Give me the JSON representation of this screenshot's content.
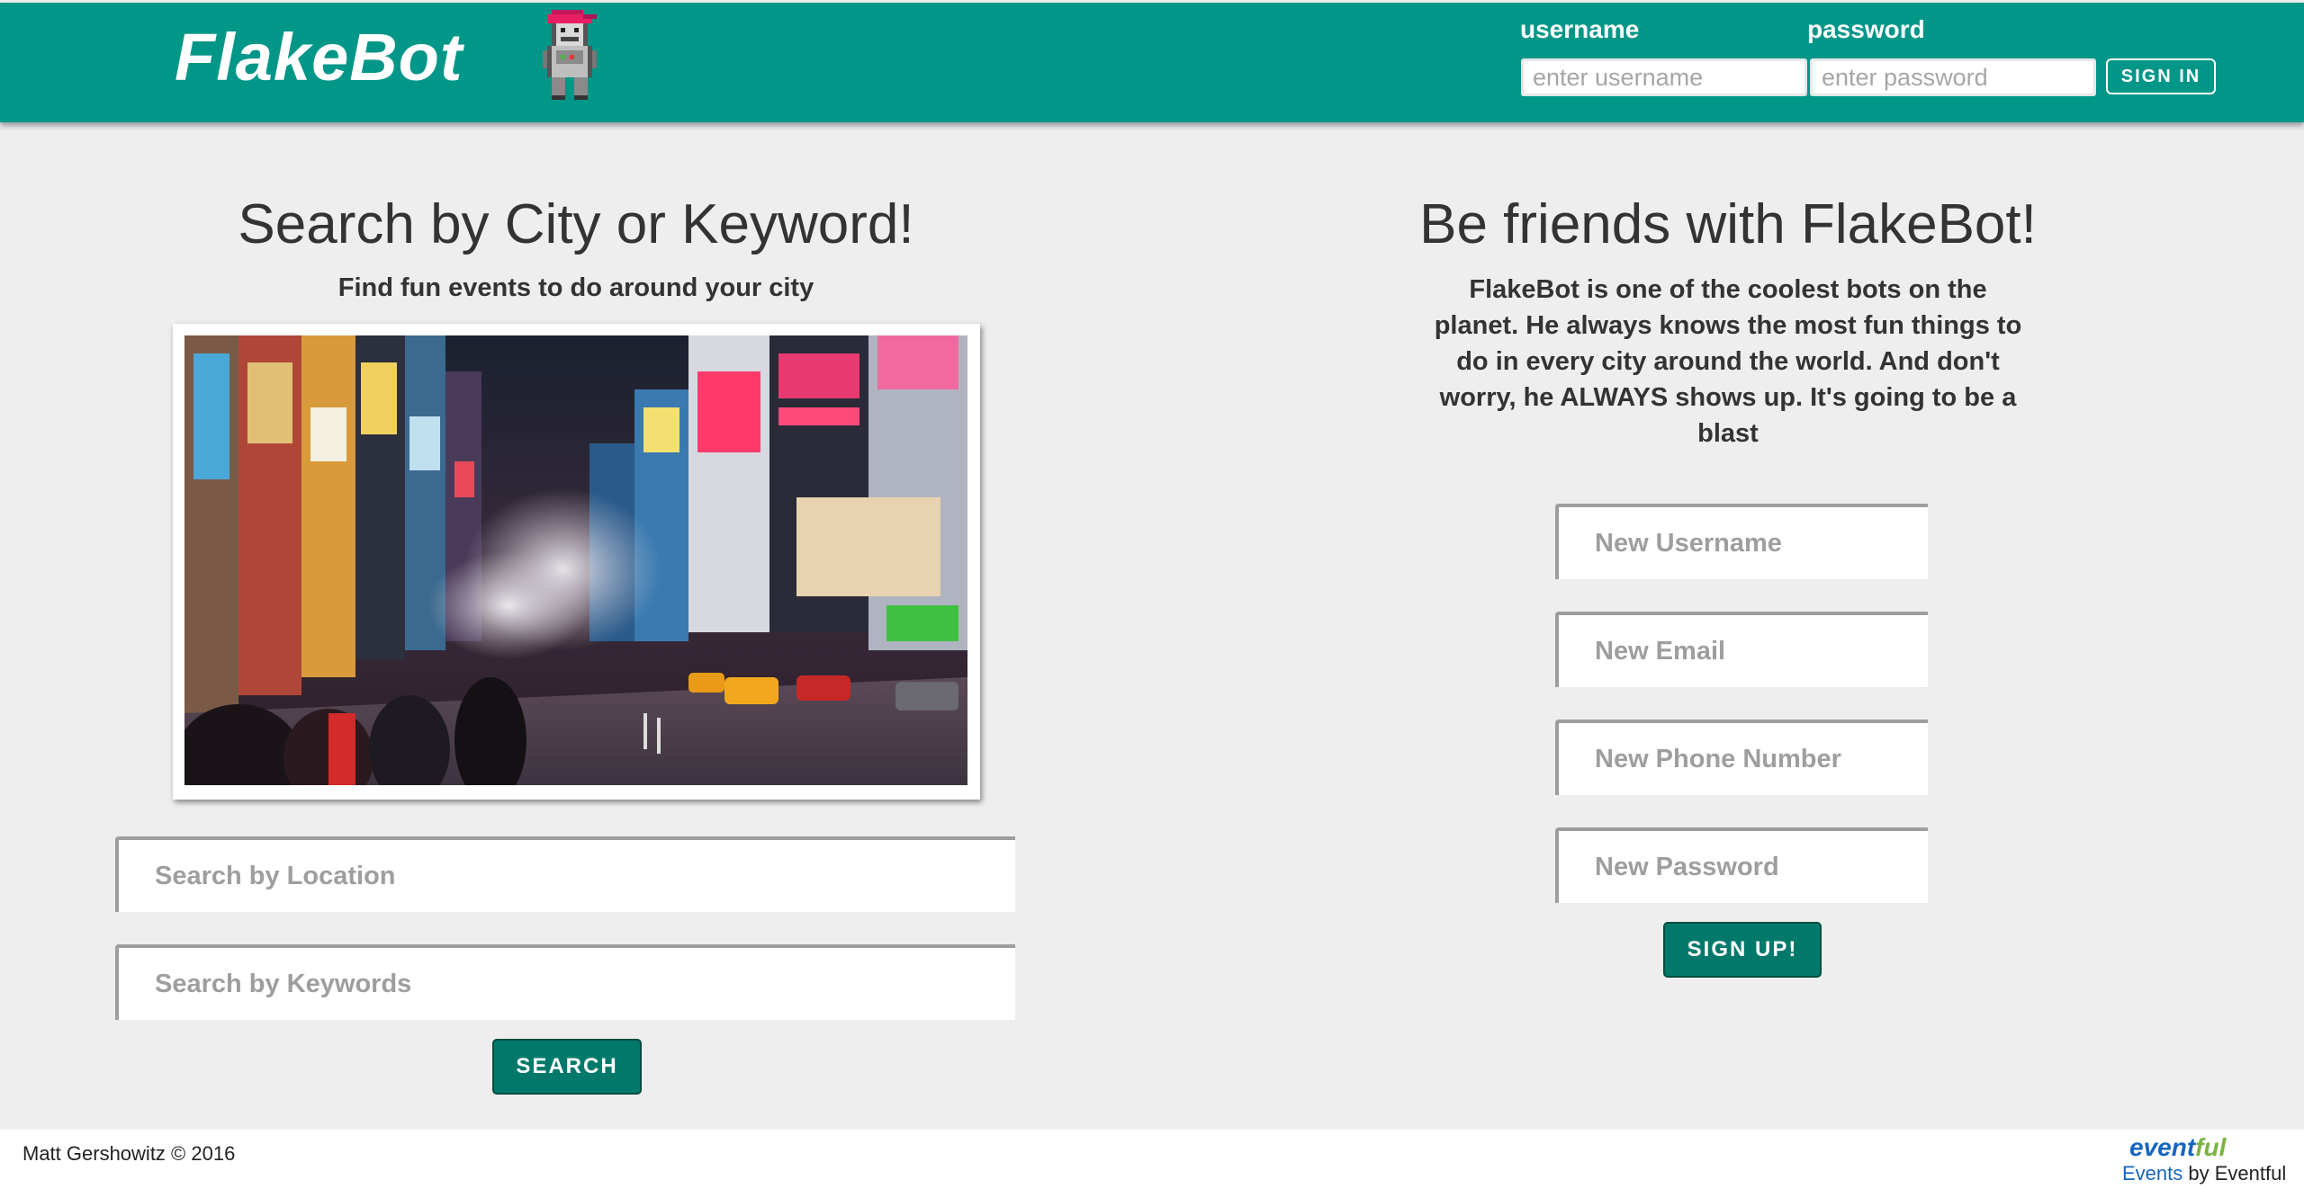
{
  "header": {
    "logo_text": "FlakeBot",
    "username_label": "username",
    "password_label": "password",
    "username_placeholder": "enter username",
    "password_placeholder": "enter password",
    "sign_in_label": "SIGN IN"
  },
  "search": {
    "title": "Search by City or Keyword!",
    "subtitle": "Find fun events to do around your city",
    "location_placeholder": "Search by Location",
    "keywords_placeholder": "Search by Keywords",
    "button_label": "SEARCH"
  },
  "signup": {
    "title": "Be friends with FlakeBot!",
    "description": "FlakeBot is one of the coolest bots on the planet. He always knows the most fun things to do in every city around the world. And don't worry, he ALWAYS shows up. It's going to be a blast",
    "username_placeholder": "New Username",
    "email_placeholder": "New Email",
    "phone_placeholder": "New Phone Number",
    "password_placeholder": "New Password",
    "button_label": "SIGN UP!"
  },
  "footer": {
    "copyright": "Matt Gershowitz © 2016",
    "eventful_logo_main": "event",
    "eventful_logo_accent": "ful",
    "credit_link": "Events",
    "credit_suffix": " by Eventful"
  },
  "colors": {
    "header_bg": "#009688",
    "button_bg": "#00796b",
    "page_bg": "#eeeeee"
  },
  "icons": {
    "bot": "pixel-robot-icon",
    "photo": "times-square-night-photo"
  }
}
